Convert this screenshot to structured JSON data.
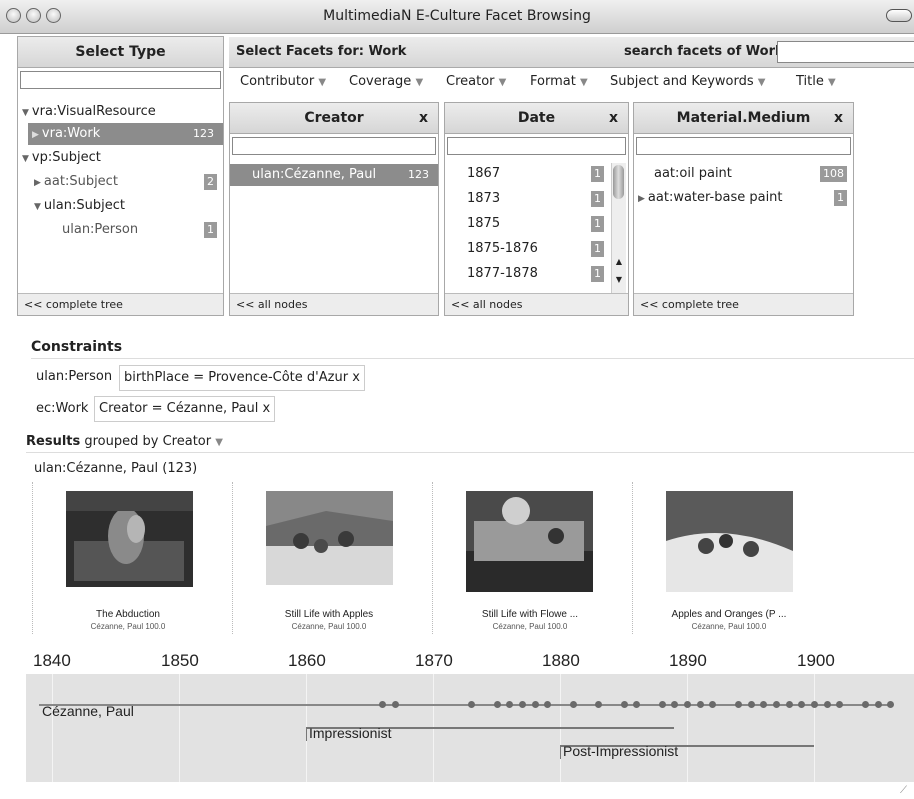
{
  "window": {
    "title": "MultimediaN E-Culture Facet Browsing"
  },
  "select_type": {
    "header": "Select Type",
    "items": [
      {
        "label": "vra:VisualResource",
        "count": ""
      },
      {
        "label": "vra:Work",
        "count": "123"
      },
      {
        "label": "vp:Subject",
        "count": ""
      },
      {
        "label": "aat:Subject",
        "count": "2"
      },
      {
        "label": "ulan:Subject",
        "count": ""
      },
      {
        "label": "ulan:Person",
        "count": "1"
      }
    ],
    "footer": "<< complete tree"
  },
  "facets_bar": {
    "title": "Select Facets for: Work",
    "search_label": "search facets of Work:",
    "menus": [
      "Contributor",
      "Coverage",
      "Creator",
      "Format",
      "Subject and Keywords",
      "Title"
    ]
  },
  "creator_panel": {
    "header": "Creator",
    "close": "x",
    "items": [
      {
        "label": "ulan:Cézanne, Paul",
        "count": "123"
      }
    ],
    "footer": "<< all nodes"
  },
  "date_panel": {
    "header": "Date",
    "close": "x",
    "items": [
      {
        "label": "1867",
        "count": "1"
      },
      {
        "label": "1873",
        "count": "1"
      },
      {
        "label": "1875",
        "count": "1"
      },
      {
        "label": "1875-1876",
        "count": "1"
      },
      {
        "label": "1877-1878",
        "count": "1"
      }
    ],
    "footer": "<< all nodes"
  },
  "material_panel": {
    "header": "Material.Medium",
    "close": "x",
    "items": [
      {
        "label": "aat:oil paint",
        "count": "108"
      },
      {
        "label": "aat:water-base paint",
        "count": "1"
      }
    ],
    "footer": "<< complete tree"
  },
  "constraints": {
    "heading": "Constraints",
    "items": [
      {
        "type": "ulan:Person",
        "value": "birthPlace = Provence-Côte d'Azur",
        "remove": "x"
      },
      {
        "type": "ec:Work",
        "value": "Creator = Cézanne, Paul",
        "remove": "x"
      }
    ]
  },
  "results": {
    "heading_bold": "Results",
    "heading_rest": "grouped by Creator",
    "group_label": "ulan:Cézanne, Paul (123)",
    "works": [
      {
        "title": "The Abduction",
        "subtitle": "Cézanne, Paul 100.0"
      },
      {
        "title": "Still Life with Apples",
        "subtitle": "Cézanne, Paul 100.0"
      },
      {
        "title": "Still Life with Flowe ...",
        "subtitle": "Cézanne, Paul 100.0"
      },
      {
        "title": "Apples and Oranges (P ...",
        "subtitle": "Cézanne, Paul 100.0"
      }
    ]
  },
  "timeline": {
    "years": [
      "1840",
      "1850",
      "1860",
      "1870",
      "1880",
      "1890",
      "1900"
    ],
    "person": "Cézanne, Paul",
    "periods": [
      {
        "label": "Impressionist",
        "start": 1860,
        "end": 1889
      },
      {
        "label": "Post-Impressionist",
        "start": 1880,
        "end": 1900
      }
    ],
    "life_span": [
      1839,
      1906
    ],
    "work_years": [
      1866,
      1867,
      1873,
      1875,
      1876,
      1877,
      1878,
      1879,
      1881,
      1883,
      1885,
      1886,
      1888,
      1889,
      1890,
      1891,
      1892,
      1894,
      1895,
      1896,
      1897,
      1898,
      1899,
      1900,
      1901,
      1902,
      1904,
      1905,
      1906
    ]
  }
}
